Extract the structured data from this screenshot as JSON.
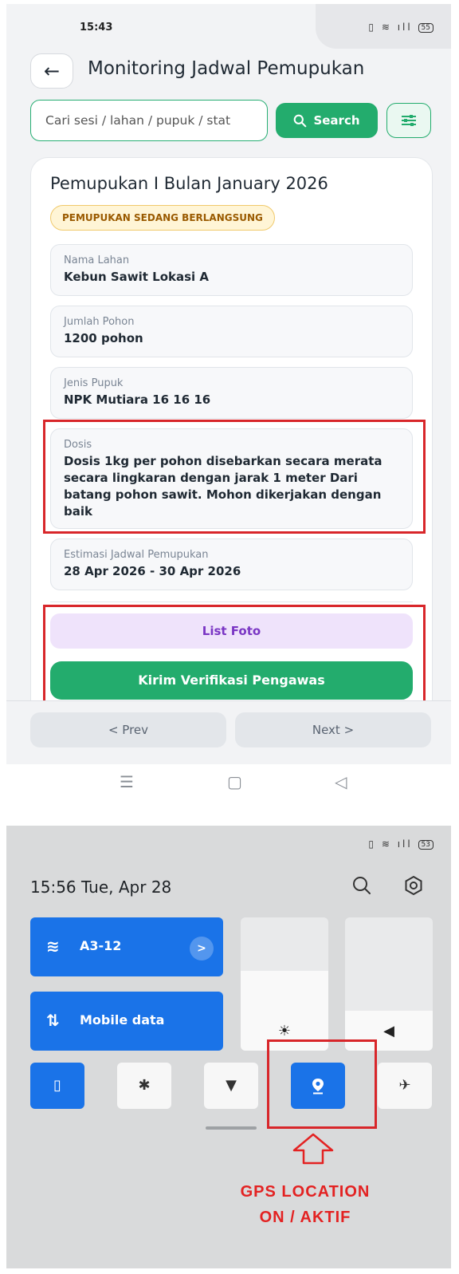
{
  "top_screen": {
    "status_time": "15:43",
    "battery": "55",
    "title": "Monitoring Jadwal Pemupukan",
    "search": {
      "placeholder": "Cari sesi / lahan / pupuk / stat",
      "button_label": "Search"
    },
    "card": {
      "title": "Pemupukan I Bulan January 2026",
      "status_badge": "PEMUPUKAN SEDANG BERLANGSUNG",
      "fields": [
        {
          "label": "Nama Lahan",
          "value": "Kebun Sawit Lokasi A"
        },
        {
          "label": "Jumlah Pohon",
          "value": "1200 pohon"
        },
        {
          "label": "Jenis Pupuk",
          "value": "NPK Mutiara 16 16 16"
        },
        {
          "label": "Dosis",
          "value": "Dosis 1kg per pohon disebarkan secara merata secara lingkaran dengan jarak 1 meter Dari batang pohon sawit. Mohon dikerjakan dengan baik"
        },
        {
          "label": "Estimasi Jadwal Pemupukan",
          "value": "28 Apr 2026 - 30 Apr 2026"
        }
      ],
      "list_foto_label": "List Foto",
      "kirim_label": "Kirim Verifikasi Pengawas"
    },
    "nav": {
      "prev_label": "< Prev",
      "next_label": "Next >"
    }
  },
  "quick_settings": {
    "battery": "53",
    "datetime": "15:56  Tue, Apr 28",
    "wifi_label": "A3-12",
    "mobile_data_label": "Mobile data",
    "brightness_level": 0.6,
    "volume_level": 0.3,
    "location_active": true
  },
  "annotation": {
    "line1": "GPS LOCATION",
    "line2": "ON / AKTIF",
    "color": "#e32222"
  },
  "colors": {
    "primary_green": "#23ac6d",
    "quick_tile_blue": "#1a73e8",
    "highlight_red": "#d8262a"
  },
  "icons": [
    "back-arrow-icon",
    "search-icon",
    "filter-icon",
    "wifi-icon",
    "mobile-data-icon",
    "brightness-icon",
    "volume-icon",
    "vibrate-icon",
    "bluetooth-icon",
    "flashlight-icon",
    "location-icon",
    "airplane-icon",
    "settings-icon"
  ]
}
